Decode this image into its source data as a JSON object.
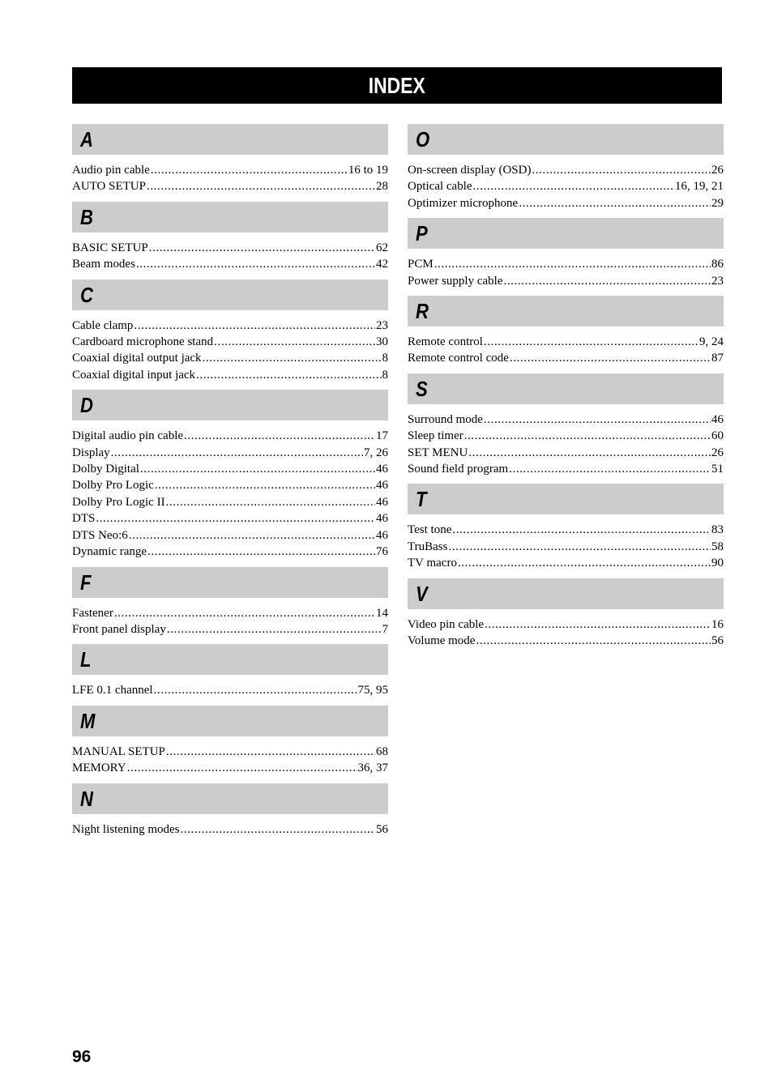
{
  "title": "INDEX",
  "page_number": "96",
  "left_column": [
    {
      "letter": "A",
      "entries": [
        {
          "term": "Audio pin cable",
          "pages": "16 to 19"
        },
        {
          "term": "AUTO SETUP",
          "pages": "28"
        }
      ]
    },
    {
      "letter": "B",
      "entries": [
        {
          "term": "BASIC SETUP",
          "pages": "62"
        },
        {
          "term": "Beam modes",
          "pages": "42"
        }
      ]
    },
    {
      "letter": "C",
      "entries": [
        {
          "term": "Cable clamp",
          "pages": "23"
        },
        {
          "term": "Cardboard microphone stand",
          "pages": "30"
        },
        {
          "term": "Coaxial digital output jack",
          "pages": "8"
        },
        {
          "term": "Coaxial digital input jack",
          "pages": "8"
        }
      ]
    },
    {
      "letter": "D",
      "entries": [
        {
          "term": "Digital audio pin cable",
          "pages": "17"
        },
        {
          "term": "Display",
          "pages": "7, 26"
        },
        {
          "term": "Dolby Digital",
          "pages": "46"
        },
        {
          "term": "Dolby Pro Logic",
          "pages": "46"
        },
        {
          "term": "Dolby Pro Logic II",
          "pages": "46"
        },
        {
          "term": "DTS",
          "pages": "46"
        },
        {
          "term": "DTS Neo:6",
          "pages": "46"
        },
        {
          "term": "Dynamic range",
          "pages": "76"
        }
      ]
    },
    {
      "letter": "F",
      "entries": [
        {
          "term": "Fastener",
          "pages": "14"
        },
        {
          "term": "Front panel display",
          "pages": "7"
        }
      ]
    },
    {
      "letter": "L",
      "entries": [
        {
          "term": "LFE 0.1 channel",
          "pages": "75, 95"
        }
      ]
    },
    {
      "letter": "M",
      "entries": [
        {
          "term": "MANUAL SETUP",
          "pages": "68"
        },
        {
          "term": "MEMORY",
          "pages": "36, 37"
        }
      ]
    },
    {
      "letter": "N",
      "entries": [
        {
          "term": "Night listening modes",
          "pages": "56"
        }
      ]
    }
  ],
  "right_column": [
    {
      "letter": "O",
      "entries": [
        {
          "term": "On-screen display (OSD)",
          "pages": "26"
        },
        {
          "term": "Optical cable",
          "pages": "16, 19, 21"
        },
        {
          "term": "Optimizer microphone",
          "pages": "29"
        }
      ]
    },
    {
      "letter": "P",
      "entries": [
        {
          "term": "PCM",
          "pages": "86"
        },
        {
          "term": "Power supply cable",
          "pages": "23"
        }
      ]
    },
    {
      "letter": "R",
      "entries": [
        {
          "term": "Remote control",
          "pages": "9, 24"
        },
        {
          "term": "Remote control code",
          "pages": "87"
        }
      ]
    },
    {
      "letter": "S",
      "entries": [
        {
          "term": "Surround mode",
          "pages": "46"
        },
        {
          "term": "Sleep timer",
          "pages": "60"
        },
        {
          "term": "SET MENU",
          "pages": "26"
        },
        {
          "term": "Sound field program",
          "pages": "51"
        }
      ]
    },
    {
      "letter": "T",
      "entries": [
        {
          "term": "Test tone",
          "pages": "83"
        },
        {
          "term": "TruBass",
          "pages": "58"
        },
        {
          "term": "TV macro",
          "pages": "90"
        }
      ]
    },
    {
      "letter": "V",
      "entries": [
        {
          "term": "Video pin cable",
          "pages": "16"
        },
        {
          "term": "Volume mode",
          "pages": "56"
        }
      ]
    }
  ]
}
